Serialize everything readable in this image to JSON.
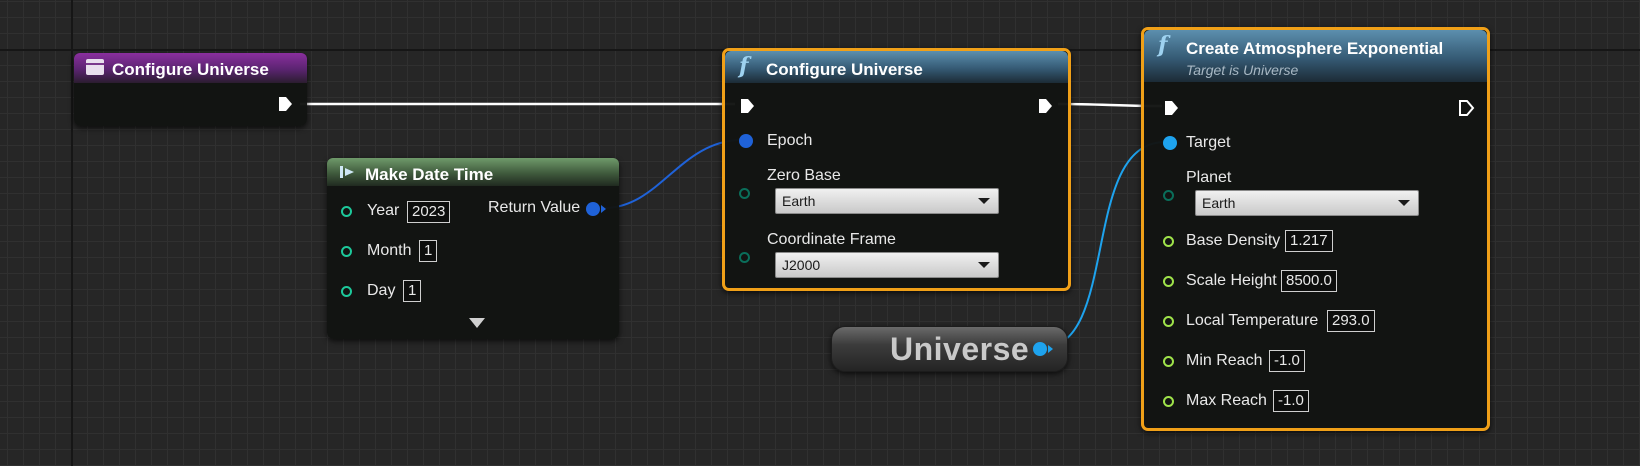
{
  "colors": {
    "exec": "#ffffff",
    "struct_pin": "#1f62d8",
    "int_pin": "#1dc99b",
    "object_pin": "#1ea3ee",
    "float_pin": "#9fe34a",
    "byte_pin": "#0a6e5a",
    "selection": "#f0a018"
  },
  "event_node": {
    "title": "Configure Universe",
    "icon": "event-icon"
  },
  "make_date_time": {
    "title": "Make Date Time",
    "icon": "make-struct-icon",
    "pins": [
      {
        "label": "Year",
        "value": "2023"
      },
      {
        "label": "Month",
        "value": "1"
      },
      {
        "label": "Day",
        "value": "1"
      }
    ],
    "output_label": "Return Value",
    "expand_icon": "chevron-down-icon"
  },
  "configure_call": {
    "title": "Configure Universe",
    "icon": "function-icon",
    "epoch_label": "Epoch",
    "zero_base_label": "Zero Base",
    "zero_base_value": "Earth",
    "coordinate_frame_label": "Coordinate Frame",
    "coordinate_frame_value": "J2000"
  },
  "universe_variable": {
    "label": "Universe"
  },
  "create_atmosphere": {
    "title": "Create Atmosphere Exponential",
    "subtitle": "Target is Universe",
    "icon": "function-icon",
    "target_label": "Target",
    "planet_label": "Planet",
    "planet_value": "Earth",
    "floats": [
      {
        "label": "Base Density",
        "value": "1.217"
      },
      {
        "label": "Scale Height",
        "value": "8500.0"
      },
      {
        "label": "Local Temperature",
        "value": "293.0"
      },
      {
        "label": "Min Reach",
        "value": "-1.0"
      },
      {
        "label": "Max Reach",
        "value": "-1.0"
      }
    ]
  }
}
